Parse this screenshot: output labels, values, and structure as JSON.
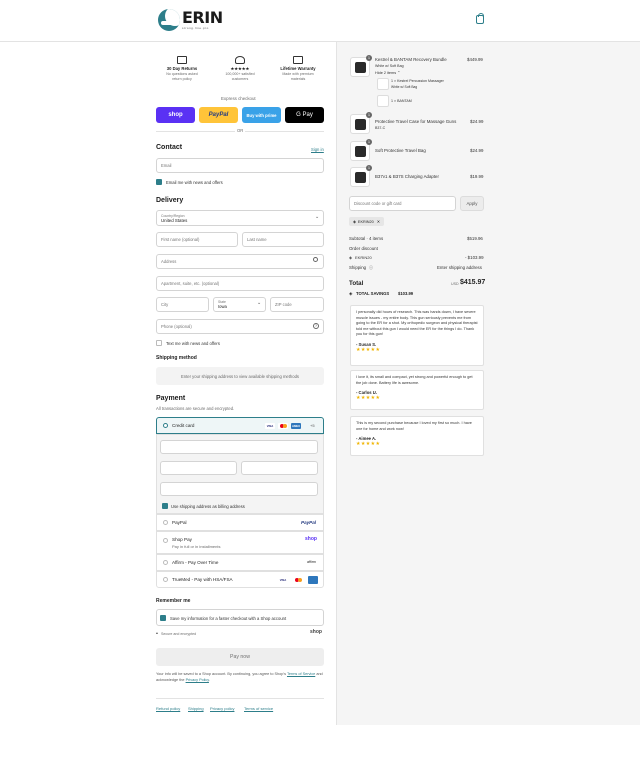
{
  "header": {
    "brand": "ERIN",
    "tagline": "strong·line·pro"
  },
  "perks": [
    {
      "title": "30 Day Returns",
      "line1": "No questions asked",
      "line2": "return policy"
    },
    {
      "title": "★★★★★",
      "line1": "100,000+ satisfied",
      "line2": "customers"
    },
    {
      "title": "Lifetime Warranty",
      "line1": "Made with premium",
      "line2": "materials"
    }
  ],
  "express": {
    "label": "Express checkout",
    "shop": "shop",
    "paypal": "PayPal",
    "amazon": "Buy with prime",
    "gpay": "G Pay",
    "or": "OR"
  },
  "contact": {
    "title": "Contact",
    "sign_in": "Sign in",
    "email_placeholder": "Email",
    "email_news": "Email me with news and offers"
  },
  "delivery": {
    "title": "Delivery",
    "country_label": "Country/Region",
    "country_value": "United States",
    "first_name": "First name (optional)",
    "last_name": "Last name",
    "address": "Address",
    "apartment": "Apartment, suite, etc. (optional)",
    "city": "City",
    "state_label": "State",
    "state_value": "Iowa",
    "zip": "ZIP code",
    "phone": "Phone (optional)",
    "text_news": "Text me with news and offers",
    "shipping_method_title": "Shipping method",
    "shipping_method_msg": "Enter your shipping address to view available shipping methods"
  },
  "payment": {
    "title": "Payment",
    "subtitle": "All transactions are secure and encrypted.",
    "credit_card": "Credit card",
    "more_cards": "+5",
    "billing_same": "Use shipping address as billing address",
    "paypal": "PayPal",
    "shop_pay": "Shop Pay",
    "shop_pay_sub": "Pay in full or in installments",
    "affirm": "Affirm - Pay Over Time",
    "truemed": "TrueMed - Pay with HSA/FSA",
    "visa": "VISA",
    "amex": "AMEX",
    "shop_logo": "shop",
    "paypal_logo": "PayPal",
    "affirm_logo": "affirm"
  },
  "remember": {
    "title": "Remember me",
    "save_info": "Save my information for a faster checkout with a Shop account",
    "secure": "Secure and encrypted",
    "shop_logo": "shop"
  },
  "pay_now": "Pay now",
  "legal": {
    "line1": "Your info will be saved to a Shop account. By continuing, you agree to Shop's",
    "terms": "Terms of Service",
    "and": "and acknowledge the",
    "privacy": "Privacy Policy",
    "period": "."
  },
  "footer_links": [
    "Refund policy",
    "Shipping",
    "Privacy policy",
    "Terms of service"
  ],
  "cart": {
    "items": [
      {
        "qty": "1",
        "name": "Kestrel & BANTAM Recovery Bundle",
        "variant": "White w/ Soft Bag",
        "price": "$449.99"
      },
      {
        "qty": "1",
        "name": "Protective Travel Case for Massage Guns",
        "variant": "B37-C",
        "price": "$24.99"
      },
      {
        "qty": "1",
        "name": "Soft Protective Travel Bag",
        "variant": "",
        "price": "$24.99"
      },
      {
        "qty": "1",
        "name": "B37v1 & B37S Charging Adapter",
        "variant": "",
        "price": "$19.99"
      }
    ],
    "hide_items": "Hide 2 items ⌃",
    "sub_items": [
      {
        "name": "1 × Kestrel Percussion Massager",
        "variant": "White w/ Soft Bag"
      },
      {
        "name": "1 × BANTAM",
        "variant": ""
      }
    ],
    "discount_placeholder": "Discount code or gift card",
    "apply": "Apply",
    "code": "EKRIN20",
    "subtotal_label": "Subtotal · 4 items",
    "subtotal_value": "$519.96",
    "order_discount": "Order discount",
    "discount_code": "EKRIN20",
    "discount_value": "- $103.99",
    "shipping_label": "Shipping",
    "shipping_value": "Enter shipping address",
    "total_label": "Total",
    "currency": "USD",
    "total_value": "$415.97",
    "savings_label": "TOTAL SAVINGS",
    "savings_value": "$103.99"
  },
  "reviews": [
    {
      "text": "I personally did hours of research. This was hands down, I have severe muscle issues - my entire body. This gun seriously prevents me from going to the ER for a shot. My orthopedic surgeon and physical therapist told me without this gun I would need the ER for the things I do. Thank you for this gun!",
      "name": "- Susan S.",
      "stars": "★★★★★"
    },
    {
      "text": "I love it, its small and compact, yet strong and powerful enough to get the job done. Battery life is awesome.",
      "name": "- Carlos U.",
      "stars": "★★★★★"
    },
    {
      "text": "This is my second purchase because I loved my first so much. I have one for home and work now!",
      "name": "- Aimee A.",
      "stars": "★★★★★"
    }
  ],
  "colors": {
    "accent": "#2d7e8a",
    "shop": "#5a31f4",
    "paypal": "#ffc439",
    "amazon": "#3aa2e8"
  }
}
